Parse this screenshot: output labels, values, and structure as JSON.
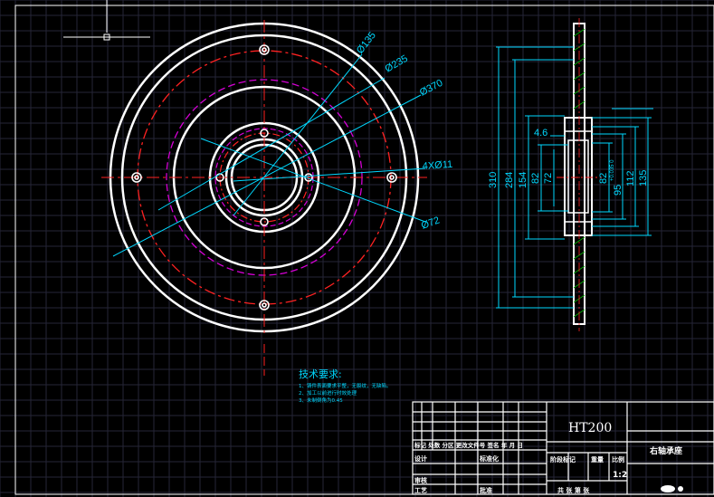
{
  "colors": {
    "background": "#000000",
    "grid": "#262637",
    "outline": "#ffffff",
    "dimension": "#00d8ff",
    "center": "#ff2222",
    "hatch": "#00aa00",
    "construction": "#d400d4"
  },
  "front_view": {
    "dims": {
      "d135": "Ø135",
      "d235": "Ø235",
      "d370": "Ø370",
      "holes": "4XØ11",
      "d72": "Ø72"
    }
  },
  "section_view": {
    "dims": {
      "h310": "310",
      "h284": "284",
      "h154": "154",
      "h82": "82",
      "h72": "72",
      "h82r": "82",
      "h95": "95",
      "tol": "+0.035\n0",
      "h112": "112",
      "h135": "135",
      "w46": "4.6"
    }
  },
  "notes": {
    "heading": "技术要求:",
    "line1": "1、铸件表面要求平整，无裂纹，无缺陷。",
    "line2": "2、加工以前进行时效处理",
    "line3": "3、未制倒角为0.45"
  },
  "title_block": {
    "material": "HT200",
    "part_name": "右轴承座",
    "row_labels": "标记 处数 分区 更改文件号 签名 年 月 日",
    "design": "设计",
    "std": "标准化",
    "process": "工艺",
    "approve": "批准",
    "review": "审核",
    "stage_label": "阶段标记",
    "weight_label": "重量",
    "scale_label": "比例",
    "scale": "1:2",
    "sheets": "共 张 第 张"
  }
}
